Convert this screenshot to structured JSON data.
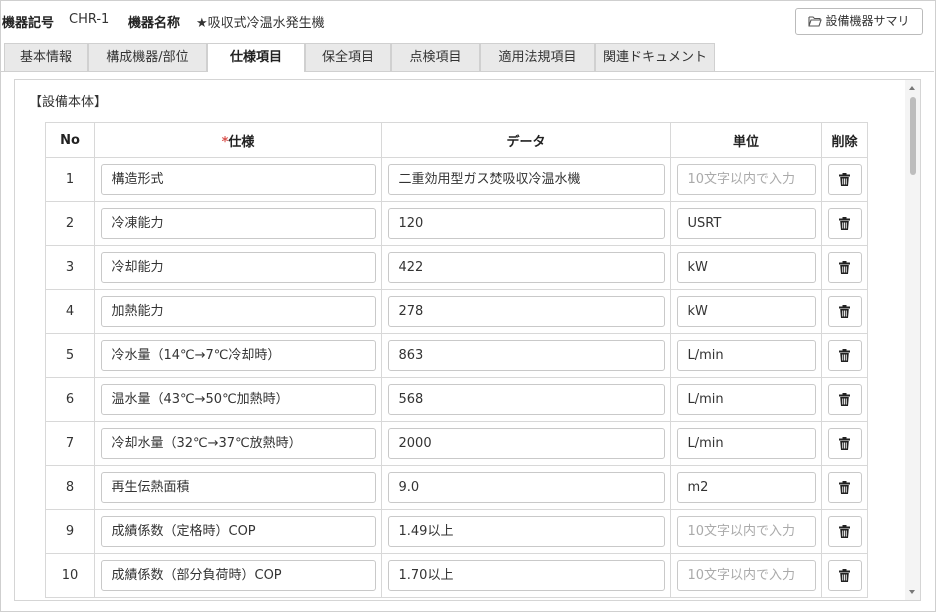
{
  "header": {
    "code_label": "機器記号",
    "code_value": "CHR-1",
    "name_label": "機器名称",
    "name_value": "★吸収式冷温水発生機",
    "summary_button": "設備機器サマリ"
  },
  "tabs": [
    {
      "label": "基本情報"
    },
    {
      "label": "構成機器/部位"
    },
    {
      "label": "仕様項目",
      "active": true
    },
    {
      "label": "保全項目"
    },
    {
      "label": "点検項目"
    },
    {
      "label": "適用法規項目"
    },
    {
      "label": "関連ドキュメント"
    }
  ],
  "section_title": "【設備本体】",
  "table": {
    "headers": {
      "no": "No",
      "required_mark": "*",
      "spec": "仕様",
      "data": "データ",
      "unit": "単位",
      "delete": "削除"
    },
    "unit_placeholder": "10文字以内で入力",
    "rows": [
      {
        "no": "1",
        "spec": "構造形式",
        "data": "二重効用型ガス焚吸収冷温水機",
        "unit": ""
      },
      {
        "no": "2",
        "spec": "冷凍能力",
        "data": "120",
        "unit": "USRT"
      },
      {
        "no": "3",
        "spec": "冷却能力",
        "data": "422",
        "unit": "kW"
      },
      {
        "no": "4",
        "spec": "加熱能力",
        "data": "278",
        "unit": "kW"
      },
      {
        "no": "5",
        "spec": "冷水量（14℃→7℃冷却時）",
        "data": "863",
        "unit": "L/min"
      },
      {
        "no": "6",
        "spec": "温水量（43℃→50℃加熱時）",
        "data": "568",
        "unit": "L/min"
      },
      {
        "no": "7",
        "spec": "冷却水量（32℃→37℃放熱時）",
        "data": "2000",
        "unit": "L/min"
      },
      {
        "no": "8",
        "spec": "再生伝熱面積",
        "data": "9.0",
        "unit": "m2"
      },
      {
        "no": "9",
        "spec": "成績係数（定格時）COP",
        "data": "1.49以上",
        "unit": ""
      },
      {
        "no": "10",
        "spec": "成績係数（部分負荷時）COP",
        "data": "1.70以上",
        "unit": ""
      }
    ]
  }
}
